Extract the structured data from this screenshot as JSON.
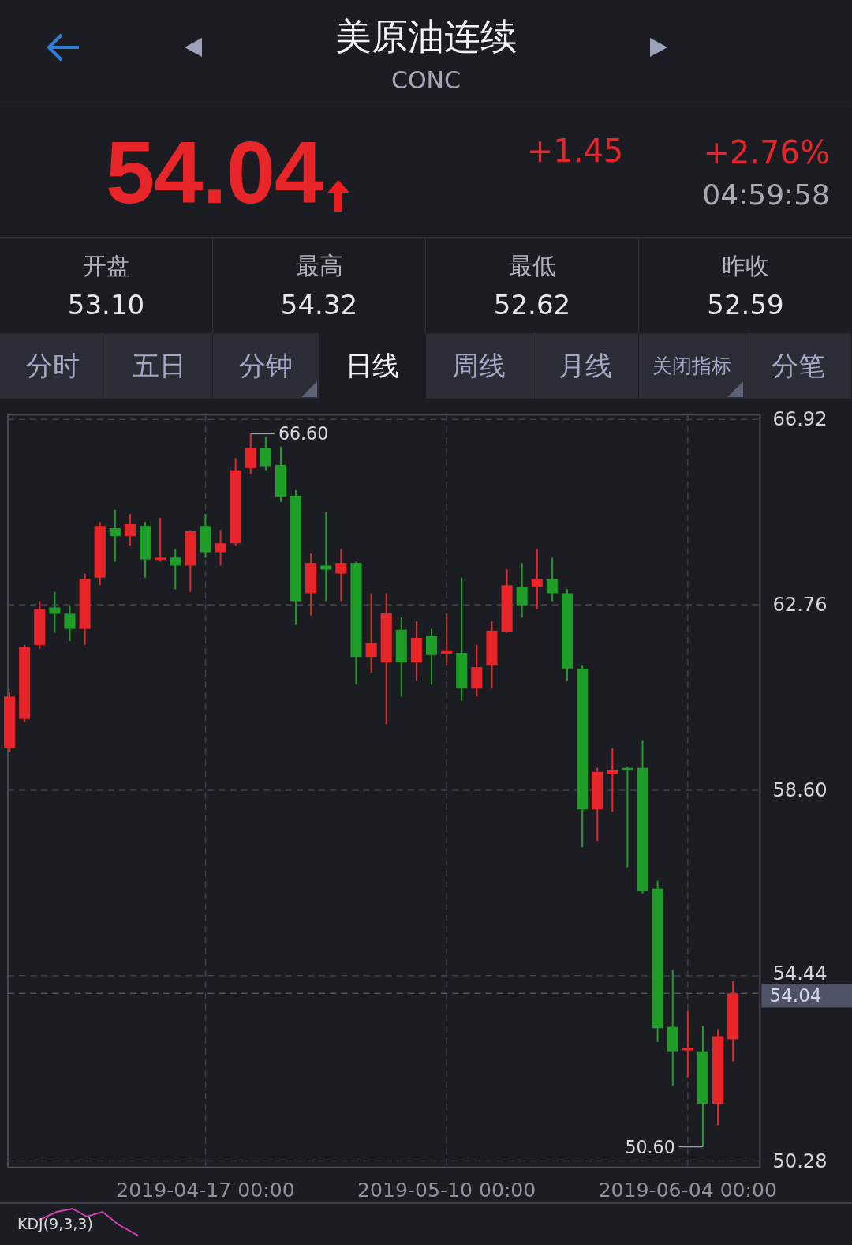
{
  "header": {
    "title": "美原油连续",
    "subtitle": "CONC"
  },
  "quote": {
    "price": "54.04",
    "rising": true,
    "change": "+1.45",
    "change_pct": "+2.76%",
    "time": "04:59:58"
  },
  "stats": [
    {
      "label": "开盘",
      "value": "53.10"
    },
    {
      "label": "最高",
      "value": "54.32"
    },
    {
      "label": "最低",
      "value": "52.62"
    },
    {
      "label": "昨收",
      "value": "52.59"
    }
  ],
  "tabs": [
    {
      "label": "分时",
      "selected": false,
      "has_menu": false
    },
    {
      "label": "五日",
      "selected": false,
      "has_menu": false
    },
    {
      "label": "分钟",
      "selected": false,
      "has_menu": true
    },
    {
      "label": "日线",
      "selected": true,
      "has_menu": false
    },
    {
      "label": "周线",
      "selected": false,
      "has_menu": false
    },
    {
      "label": "月线",
      "selected": false,
      "has_menu": false
    },
    {
      "label": "关闭指标",
      "selected": false,
      "has_menu": true
    },
    {
      "label": "分笔",
      "selected": false,
      "has_menu": false
    }
  ],
  "chart": {
    "high_label": "66.60",
    "low_label": "50.60",
    "price_tag": "54.04",
    "chart_data": {
      "type": "candlestick",
      "ylim": [
        50.28,
        66.92
      ],
      "grid": true,
      "ref_lines": [
        {
          "axis": "y",
          "value": 54.04
        }
      ],
      "yticks": [
        {
          "value": 66.92,
          "label": "66.92"
        },
        {
          "value": 62.76,
          "label": "62.76"
        },
        {
          "value": 58.6,
          "label": "58.60"
        },
        {
          "value": 54.44,
          "label": "54.44"
        },
        {
          "value": 50.28,
          "label": "50.28"
        }
      ],
      "categories": [
        null,
        null,
        null,
        null,
        null,
        null,
        null,
        null,
        null,
        null,
        null,
        null,
        null,
        "2019-04-17 00:00",
        null,
        null,
        null,
        null,
        null,
        null,
        null,
        null,
        null,
        null,
        null,
        null,
        null,
        null,
        null,
        "2019-05-10 00:00",
        null,
        null,
        null,
        null,
        null,
        null,
        null,
        null,
        null,
        null,
        null,
        null,
        null,
        null,
        null,
        "2019-06-04 00:00",
        null,
        null,
        null
      ],
      "ohlc": [
        [
          59.54,
          60.79,
          59.46,
          60.7
        ],
        [
          60.2,
          61.86,
          60.13,
          61.81
        ],
        [
          61.86,
          62.84,
          61.77,
          62.66
        ],
        [
          62.7,
          63.05,
          62.13,
          62.56
        ],
        [
          62.56,
          62.75,
          61.95,
          62.22
        ],
        [
          62.22,
          63.46,
          61.86,
          63.34
        ],
        [
          63.37,
          64.62,
          63.2,
          64.53
        ],
        [
          64.48,
          64.89,
          63.73,
          64.3
        ],
        [
          64.3,
          64.8,
          64.09,
          64.57
        ],
        [
          64.53,
          64.62,
          63.37,
          63.78
        ],
        [
          63.77,
          64.71,
          63.73,
          63.82
        ],
        [
          63.82,
          64.0,
          63.11,
          63.64
        ],
        [
          63.64,
          64.44,
          63.05,
          64.41
        ],
        [
          64.53,
          64.8,
          63.82,
          63.94
        ],
        [
          63.94,
          64.44,
          63.64,
          64.14
        ],
        [
          64.14,
          66.05,
          64.09,
          65.78
        ],
        [
          65.83,
          66.6,
          65.69,
          66.28
        ],
        [
          66.28,
          66.53,
          65.78,
          65.87
        ],
        [
          65.9,
          66.31,
          65.07,
          65.19
        ],
        [
          65.21,
          65.33,
          62.31,
          62.84
        ],
        [
          63.02,
          63.91,
          62.52,
          63.7
        ],
        [
          63.64,
          64.84,
          62.84,
          63.55
        ],
        [
          63.46,
          64.0,
          62.84,
          63.7
        ],
        [
          63.7,
          63.73,
          60.97,
          61.59
        ],
        [
          61.59,
          63.02,
          61.24,
          61.9
        ],
        [
          61.47,
          63.02,
          60.08,
          62.57
        ],
        [
          62.2,
          62.48,
          60.7,
          61.47
        ],
        [
          61.47,
          62.39,
          61.06,
          62.02
        ],
        [
          62.06,
          62.22,
          60.97,
          61.63
        ],
        [
          61.66,
          62.57,
          61.41,
          61.74
        ],
        [
          61.68,
          63.37,
          60.61,
          60.88
        ],
        [
          60.88,
          61.86,
          60.7,
          61.36
        ],
        [
          61.41,
          62.39,
          60.88,
          62.18
        ],
        [
          62.16,
          63.55,
          62.13,
          63.2
        ],
        [
          63.16,
          63.7,
          62.48,
          62.75
        ],
        [
          63.16,
          64.0,
          62.66,
          63.34
        ],
        [
          63.34,
          63.82,
          62.84,
          63.02
        ],
        [
          63.02,
          63.11,
          61.06,
          61.33
        ],
        [
          61.33,
          61.41,
          57.32,
          58.17
        ],
        [
          58.17,
          59.1,
          57.46,
          59.01
        ],
        [
          58.96,
          59.54,
          58.12,
          59.06
        ],
        [
          59.1,
          59.13,
          56.87,
          59.06
        ],
        [
          59.1,
          59.72,
          56.28,
          56.34
        ],
        [
          56.39,
          56.57,
          52.95,
          53.26
        ],
        [
          53.29,
          54.56,
          51.97,
          52.74
        ],
        [
          52.76,
          53.66,
          52.15,
          52.81
        ],
        [
          52.74,
          53.31,
          50.6,
          51.56
        ],
        [
          51.56,
          53.22,
          51.08,
          53.08
        ],
        [
          53.01,
          54.32,
          52.51,
          54.04
        ]
      ]
    }
  },
  "indicator": {
    "label": "KDJ(9,3,3)"
  }
}
